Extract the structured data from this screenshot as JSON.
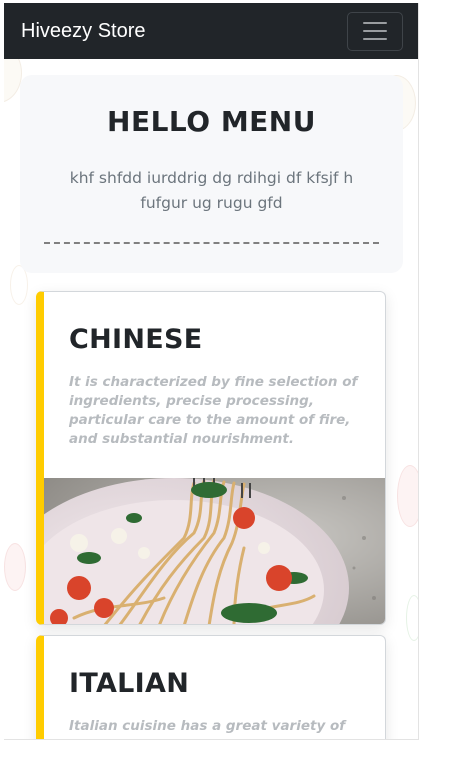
{
  "navbar": {
    "brand": "Hiveezy Store",
    "toggle_icon": "hamburger-icon"
  },
  "hero": {
    "title": "HELLO MENU",
    "subtitle": "khf shfdd iurddrig dg rdihgi df kfsjf h fufgur ug rugu gfd"
  },
  "menu": [
    {
      "title": "CHINESE",
      "description": "It is characterized by fine selection of ingredients, precise processing, particular care to the amount of fire, and substantial nourishment."
    },
    {
      "title": "ITALIAN",
      "description": "Italian cuisine has a great variety of different ingredients which are commonly"
    }
  ],
  "colors": {
    "navbar_bg": "#212529",
    "accent": "#ffcc00",
    "hero_bg": "#f7f8fa",
    "muted_text": "#6c757d"
  }
}
